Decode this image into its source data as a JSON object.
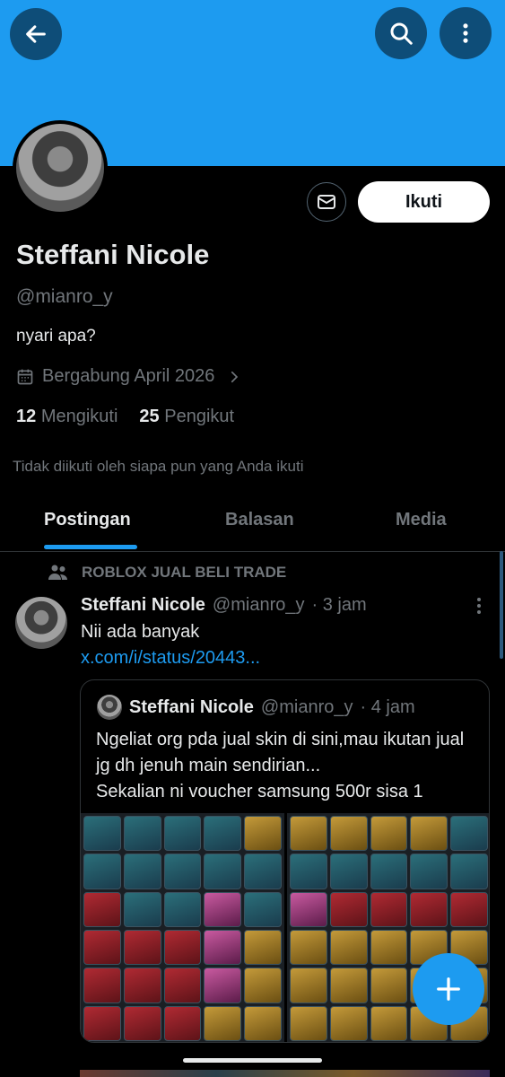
{
  "profile": {
    "name": "Steffani Nicole",
    "handle": "@mianro_y",
    "bio": "nyari apa?",
    "joined": "Bergabung April 2026",
    "following_count": "12",
    "following_label": "Mengikuti",
    "followers_count": "25",
    "followers_label": "Pengikut",
    "not_followed_text": "Tidak diikuti oleh siapa pun yang Anda ikuti",
    "follow_label": "Ikuti"
  },
  "colors": {
    "banner": "#1d9bf0",
    "accent": "#1d9bf0",
    "background": "#000000"
  },
  "icons": {
    "back": "back-arrow-icon",
    "search": "search-icon",
    "more": "more-vertical-icon",
    "message": "mail-icon",
    "calendar": "calendar-icon",
    "community": "people-icon",
    "compose": "plus-icon"
  },
  "tabs": [
    {
      "label": "Postingan",
      "active": true
    },
    {
      "label": "Balasan",
      "active": false
    },
    {
      "label": "Media",
      "active": false
    }
  ],
  "post": {
    "community": "ROBLOX JUAL BELI TRADE",
    "author_name": "Steffani Nicole",
    "author_handle": "@mianro_y",
    "time": "· 3 jam",
    "text": "Nii ada banyak",
    "link": "x.com/i/status/20443..."
  },
  "quote": {
    "author_name": "Steffani Nicole",
    "author_handle": "@mianro_y",
    "time": "· 4 jam",
    "text": "Ngeliat org pda jual skin di sini,mau ikutan jual jg dh jenuh main sendirian...\nSekalian ni voucher samsung 500r sisa 1"
  }
}
